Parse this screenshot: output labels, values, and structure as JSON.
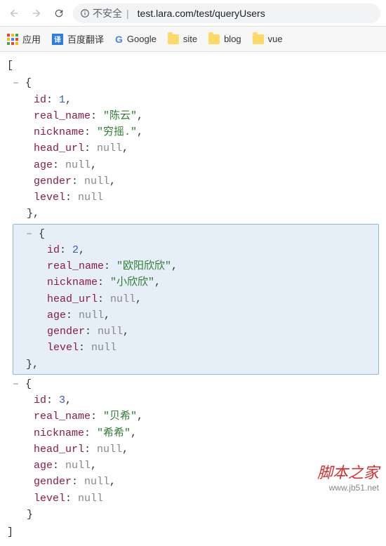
{
  "toolbar": {
    "insecure_label": "不安全",
    "url_display": "test.lara.com/test/queryUsers"
  },
  "bookmarks": {
    "apps": "应用",
    "baidu": "百度翻译",
    "google": "Google",
    "site": "site",
    "blog": "blog",
    "vue": "vue"
  },
  "json": {
    "selected_index": 1,
    "items": [
      {
        "id": 1,
        "real_name": "陈云",
        "nickname": "穷摇.",
        "head_url": null,
        "age": null,
        "gender": null,
        "level": null
      },
      {
        "id": 2,
        "real_name": "欧阳欣欣",
        "nickname": "小欣欣",
        "head_url": null,
        "age": null,
        "gender": null,
        "level": null
      },
      {
        "id": 3,
        "real_name": "贝希",
        "nickname": "希希",
        "head_url": null,
        "age": null,
        "gender": null,
        "level": null
      }
    ]
  },
  "watermark": {
    "zh": "脚本之家",
    "url": "www.jb51.net"
  }
}
